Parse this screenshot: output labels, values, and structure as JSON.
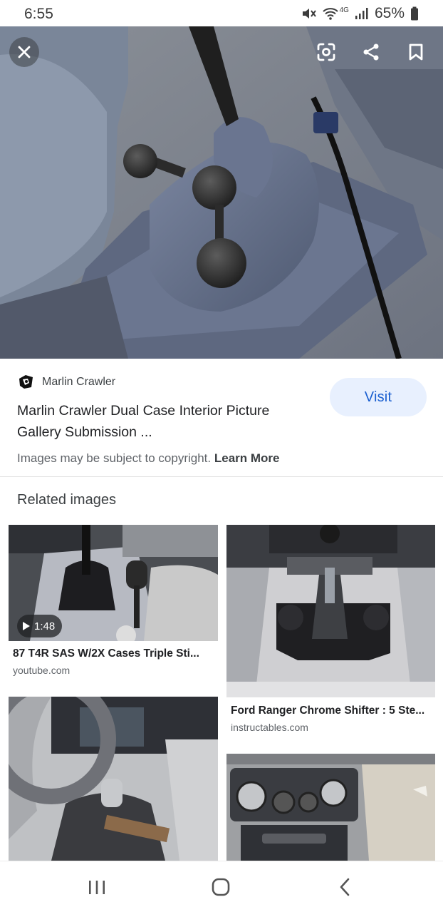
{
  "status_bar": {
    "time": "6:55",
    "network": "4G",
    "battery": "65%"
  },
  "viewer": {
    "close_icon": "close-icon",
    "lens_icon": "google-lens-icon",
    "share_icon": "share-icon",
    "save_icon": "bookmark-icon"
  },
  "result": {
    "source_name": "Marlin Crawler",
    "title": "Marlin Crawler Dual Case Interior Picture Gallery Submission ...",
    "visit_label": "Visit",
    "copyright_text": "Images may be subject to copyright.",
    "learn_more": "Learn More"
  },
  "related": {
    "heading": "Related images",
    "items": [
      {
        "title": "87 T4R SAS W/2X Cases Triple Sti...",
        "site": "youtube.com",
        "duration": "1:48"
      },
      {
        "title": "Ford Ranger Chrome Shifter : 5 Ste...",
        "site": "instructables.com"
      },
      {
        "title": "",
        "site": ""
      },
      {
        "title": "",
        "site": ""
      }
    ]
  },
  "nav": {
    "recents_icon": "recents-icon",
    "home_icon": "home-icon",
    "back_icon": "back-icon"
  },
  "colors": {
    "accent": "#1a5fd0",
    "visit_bg": "#e8f0fe"
  }
}
